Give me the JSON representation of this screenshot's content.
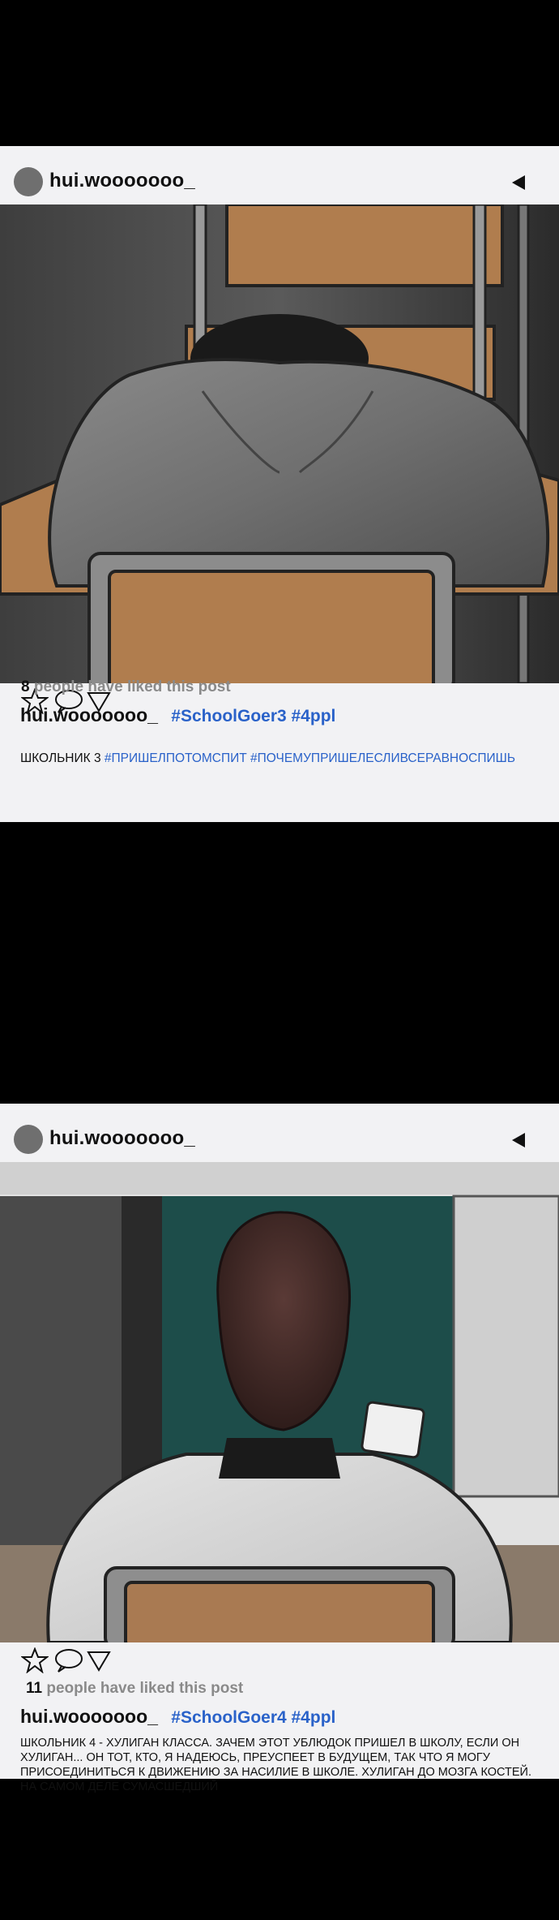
{
  "posts": [
    {
      "username": "hui.wooooooo_",
      "likes_count": "8",
      "likes_text": "people have liked this post",
      "caption_user": "hui.wooooooo_",
      "caption_tags": "#SchoolGoer3 #4ppl",
      "body_plain": "ШКОЛЬНИК 3",
      "body_tags": "#ПРИШЕЛПОТОМСПИТ #ПОЧЕМУПРИШЕЛЕСЛИВСЕРАВНОСПИШЬ"
    },
    {
      "username": "hui.wooooooo_",
      "likes_count": "11",
      "likes_text": "people have liked this post",
      "caption_user": "hui.wooooooo_",
      "caption_tags": "#SchoolGoer4 #4ppl",
      "body_plain": "ШКОЛЬНИК 4 - ХУЛИГАН КЛАССА. ЗАЧЕМ ЭТОТ УБЛЮДОК ПРИШЕЛ В ШКОЛУ, ЕСЛИ ОН ХУЛИГАН... ОН ТОТ, КТО, Я НАДЕЮСЬ, ПРЕУСПЕЕТ В БУДУЩЕМ, ТАК ЧТО Я МОГУ ПРИСОЕДИНИТЬСЯ К ДВИЖЕНИЮ ЗА НАСИЛИЕ В ШКОЛЕ. ХУЛИГАН ДО МОЗГА КОСТЕЙ. НА САМОМ ДЕЛЕ СУМАСШЕДШИЙ"
    }
  ],
  "colors": {
    "hashtag": "#2a62c9",
    "card": "#f2f2f4",
    "background": "#000000"
  },
  "icons": [
    "star-icon",
    "comment-icon",
    "share-icon",
    "play-icon"
  ]
}
